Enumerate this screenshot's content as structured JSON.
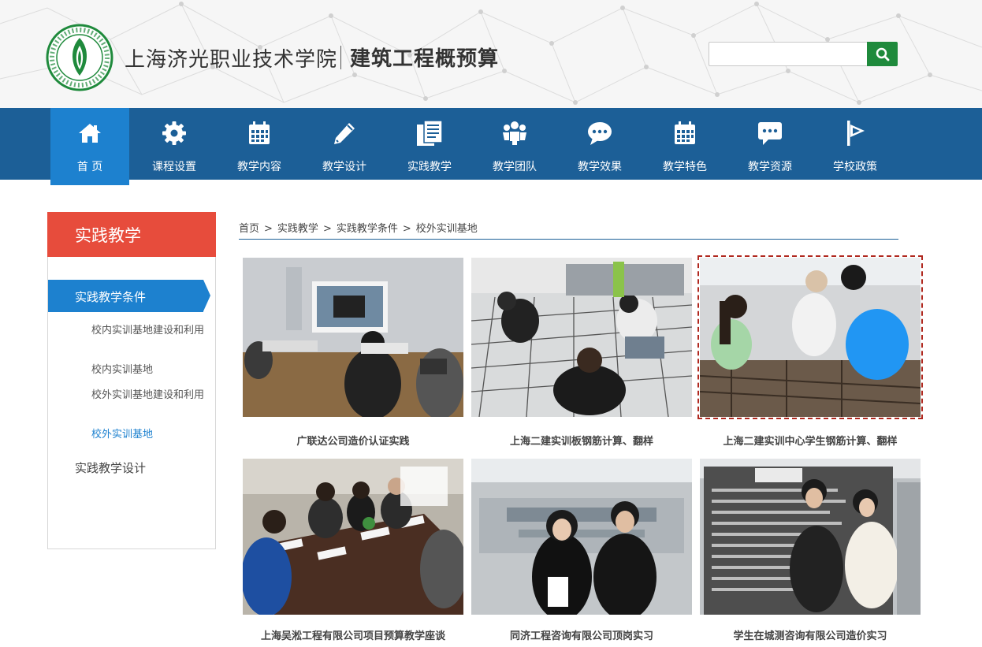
{
  "header": {
    "school_name": "上海济光职业技术学院",
    "course_name": "建筑工程概预算",
    "search": {
      "value": "",
      "placeholder": ""
    }
  },
  "nav": {
    "items": [
      {
        "label": "首 页",
        "icon": "home-icon",
        "active": true
      },
      {
        "label": "课程设置",
        "icon": "gear-icon"
      },
      {
        "label": "教学内容",
        "icon": "calendar-icon"
      },
      {
        "label": "教学设计",
        "icon": "pencil-icon"
      },
      {
        "label": "实践教学",
        "icon": "document-icon"
      },
      {
        "label": "教学团队",
        "icon": "team-icon"
      },
      {
        "label": "教学效果",
        "icon": "chat-bubble-icon"
      },
      {
        "label": "教学特色",
        "icon": "calendar-icon"
      },
      {
        "label": "教学资源",
        "icon": "message-icon"
      },
      {
        "label": "学校政策",
        "icon": "flag-icon"
      }
    ]
  },
  "sidebar": {
    "title": "实践教学",
    "active_item": "实践教学条件",
    "sub_items": [
      {
        "label": "校内实训基地建设和利用"
      },
      {
        "label": "校内实训基地"
      },
      {
        "label": "校外实训基地建设和利用"
      },
      {
        "label": "校外实训基地",
        "current": true
      }
    ],
    "other_item": "实践教学设计"
  },
  "breadcrumb": [
    "首页",
    "实践教学",
    "实践教学条件",
    "校外实训基地"
  ],
  "breadcrumb_separator": ">",
  "gallery": [
    {
      "caption": "广联达公司造价认证实践"
    },
    {
      "caption": "上海二建实训板钢筋计算、翻样"
    },
    {
      "caption": "上海二建实训中心学生钢筋计算、翻样",
      "highlighted": true
    },
    {
      "caption": "上海吴淞工程有限公司项目预算教学座谈"
    },
    {
      "caption": "同济工程咨询有限公司顶岗实习"
    },
    {
      "caption": "学生在城测咨询有限公司造价实习"
    }
  ],
  "colors": {
    "nav_bg": "#1c5f97",
    "nav_active": "#1d81cf",
    "sidebar_title": "#e74c3c",
    "search_button": "#1f8a3c",
    "logo_green": "#1f8a3c"
  }
}
